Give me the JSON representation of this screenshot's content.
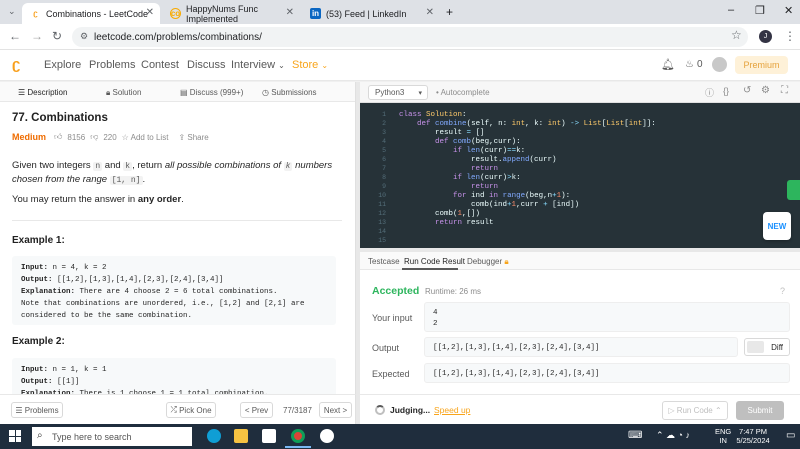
{
  "browser": {
    "tabs": [
      {
        "label": "Combinations - LeetCode",
        "active": true
      },
      {
        "label": "HappyNums Func Implemented",
        "active": false
      },
      {
        "label": "(53) Feed | LinkedIn",
        "active": false
      }
    ],
    "url": "leetcode.com/problems/combinations/"
  },
  "nav": {
    "links": [
      "Explore",
      "Problems",
      "Contest",
      "Discuss",
      "Interview",
      "Store"
    ],
    "notification_count": "0",
    "premium_label": "Premium"
  },
  "left_tabs": [
    "Description",
    "Solution",
    "Discuss (999+)",
    "Submissions"
  ],
  "problem": {
    "title": "77. Combinations",
    "difficulty": "Medium",
    "likes": "8156",
    "dislikes": "220",
    "add_to_list": "Add to List",
    "share": "Share",
    "desc_1a": "Given two integers ",
    "desc_n": "n",
    "desc_and": " and ",
    "desc_k": "k",
    "desc_1b": ", return ",
    "desc_1c": "all possible combinations of ",
    "desc_k2": "k",
    "desc_1d": " numbers chosen from the range ",
    "desc_range": "[1, n]",
    "desc_1e": ".",
    "desc_2a": "You may return the answer in ",
    "desc_2b": "any order",
    "desc_2c": ".",
    "ex1_title": "Example 1:",
    "ex1_lines": [
      "Input: n = 4, k = 2",
      "Output: [[1,2],[1,3],[1,4],[2,3],[2,4],[3,4]]",
      "Explanation: There are 4 choose 2 = 6 total combinations.",
      "Note that combinations are unordered, i.e., [1,2] and [2,1] are",
      "considered to be the same combination."
    ],
    "ex2_title": "Example 2:",
    "ex2_lines": [
      "Input: n = 1, k = 1",
      "Output: [[1]]",
      "Explanation: There is 1 choose 1 = 1 total combination."
    ]
  },
  "left_footer": {
    "problems": "Problems",
    "pick_one": "Pick One",
    "prev": "< Prev",
    "counter": "77/3187",
    "next": "Next >"
  },
  "editor": {
    "language": "Python3",
    "autocomplete": "Autocomplete",
    "line_numbers": [
      "1",
      "2",
      "3",
      "4",
      "5",
      "6",
      "7",
      "8",
      "9",
      "10",
      "11",
      "12",
      "13",
      "14",
      "15"
    ]
  },
  "new_button": "NEW",
  "result_tabs": [
    "Testcase",
    "Run Code Result",
    "Debugger"
  ],
  "result": {
    "status": "Accepted",
    "runtime": "Runtime: 26 ms",
    "your_input_label": "Your input",
    "input_lines": [
      "4",
      "2"
    ],
    "output_label": "Output",
    "output": "[[1,2],[1,3],[1,4],[2,3],[2,4],[3,4]]",
    "diff_label": "Diff",
    "expected_label": "Expected",
    "expected": "[[1,2],[1,3],[1,4],[2,3],[2,4],[3,4]]"
  },
  "right_footer": {
    "judging": "Judging...",
    "speed_up": "Speed up",
    "run_code": "Run Code",
    "submit": "Submit"
  },
  "taskbar": {
    "search_placeholder": "Type here to search",
    "lang_1": "ENG",
    "lang_2": "IN",
    "time": "7:47 PM",
    "date": "5/25/2024"
  }
}
